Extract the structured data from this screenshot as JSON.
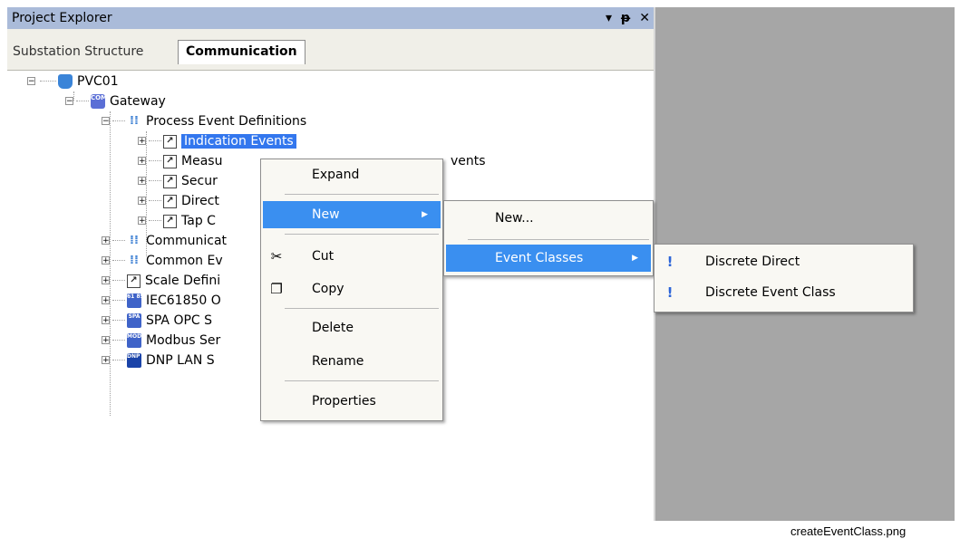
{
  "panel": {
    "title": "Project Explorer",
    "buttons": {
      "dropdown": "▾",
      "pin": "ᵽ",
      "close": "✕"
    }
  },
  "tabs": [
    "Substation Structure",
    "Communication"
  ],
  "tree": {
    "root": "PVC01",
    "gateway": "Gateway",
    "gateway_icon_text": "COM 600",
    "ped": "Process Event Definitions",
    "ped_children": [
      "Indication Events",
      "Measu",
      "Secur",
      "Direct",
      "Tap C"
    ],
    "measu_tail": "vents",
    "gateway_children": [
      "Communicat",
      "Common Ev",
      "Scale Defini",
      "IEC61850 O",
      "SPA OPC S",
      "Modbus Ser",
      "DNP LAN S"
    ],
    "gateway_child_icons": [
      "",
      "",
      "",
      "61 850",
      "SPA",
      "MOD BUS",
      "DNP LAN"
    ]
  },
  "context_menu": {
    "items": [
      "Expand",
      "New",
      "Cut",
      "Copy",
      "Delete",
      "Rename",
      "Properties"
    ],
    "icons": {
      "cut": "scissors-icon",
      "copy": "copy-icon"
    }
  },
  "submenu_new": {
    "items": [
      "New...",
      "Event Classes"
    ]
  },
  "submenu_event_classes": {
    "items": [
      "Discrete Direct",
      "Discrete Event Class"
    ],
    "icon": "exclamation-icon"
  },
  "caption": "createEventClass.png",
  "colors": {
    "titlebar": "#aabbd9",
    "highlight": "#3a8ff0",
    "selection": "#3377ee",
    "right_area": "#a6a6a6"
  }
}
